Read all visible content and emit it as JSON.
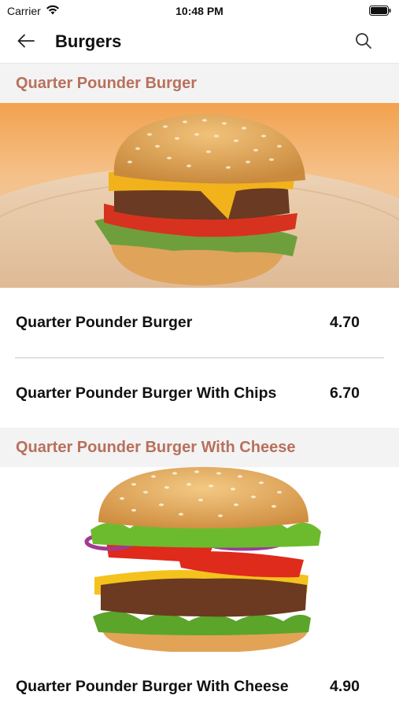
{
  "status_bar": {
    "carrier": "Carrier",
    "time": "10:48 PM",
    "icons": [
      "wifi-icon",
      "battery-icon"
    ]
  },
  "nav": {
    "title": "Burgers",
    "back_icon": "arrow-left-icon",
    "search_icon": "search-icon"
  },
  "colors": {
    "section_header_text": "#b8705c",
    "section_header_bg": "#f3f3f3",
    "divider": "#e2e2e2"
  },
  "sections": [
    {
      "title": "Quarter Pounder Burger",
      "image": "cheeseburger-on-wooden-board",
      "items": [
        {
          "name": "Quarter Pounder Burger",
          "price": "4.70"
        },
        {
          "name": "Quarter Pounder Burger With Chips",
          "price": "6.70"
        }
      ]
    },
    {
      "title": "Quarter Pounder Burger With Cheese",
      "image": "double-cheeseburger-with-lettuce-tomato-onion",
      "items": [
        {
          "name": "Quarter Pounder Burger With Cheese",
          "price": "4.90"
        }
      ]
    }
  ]
}
